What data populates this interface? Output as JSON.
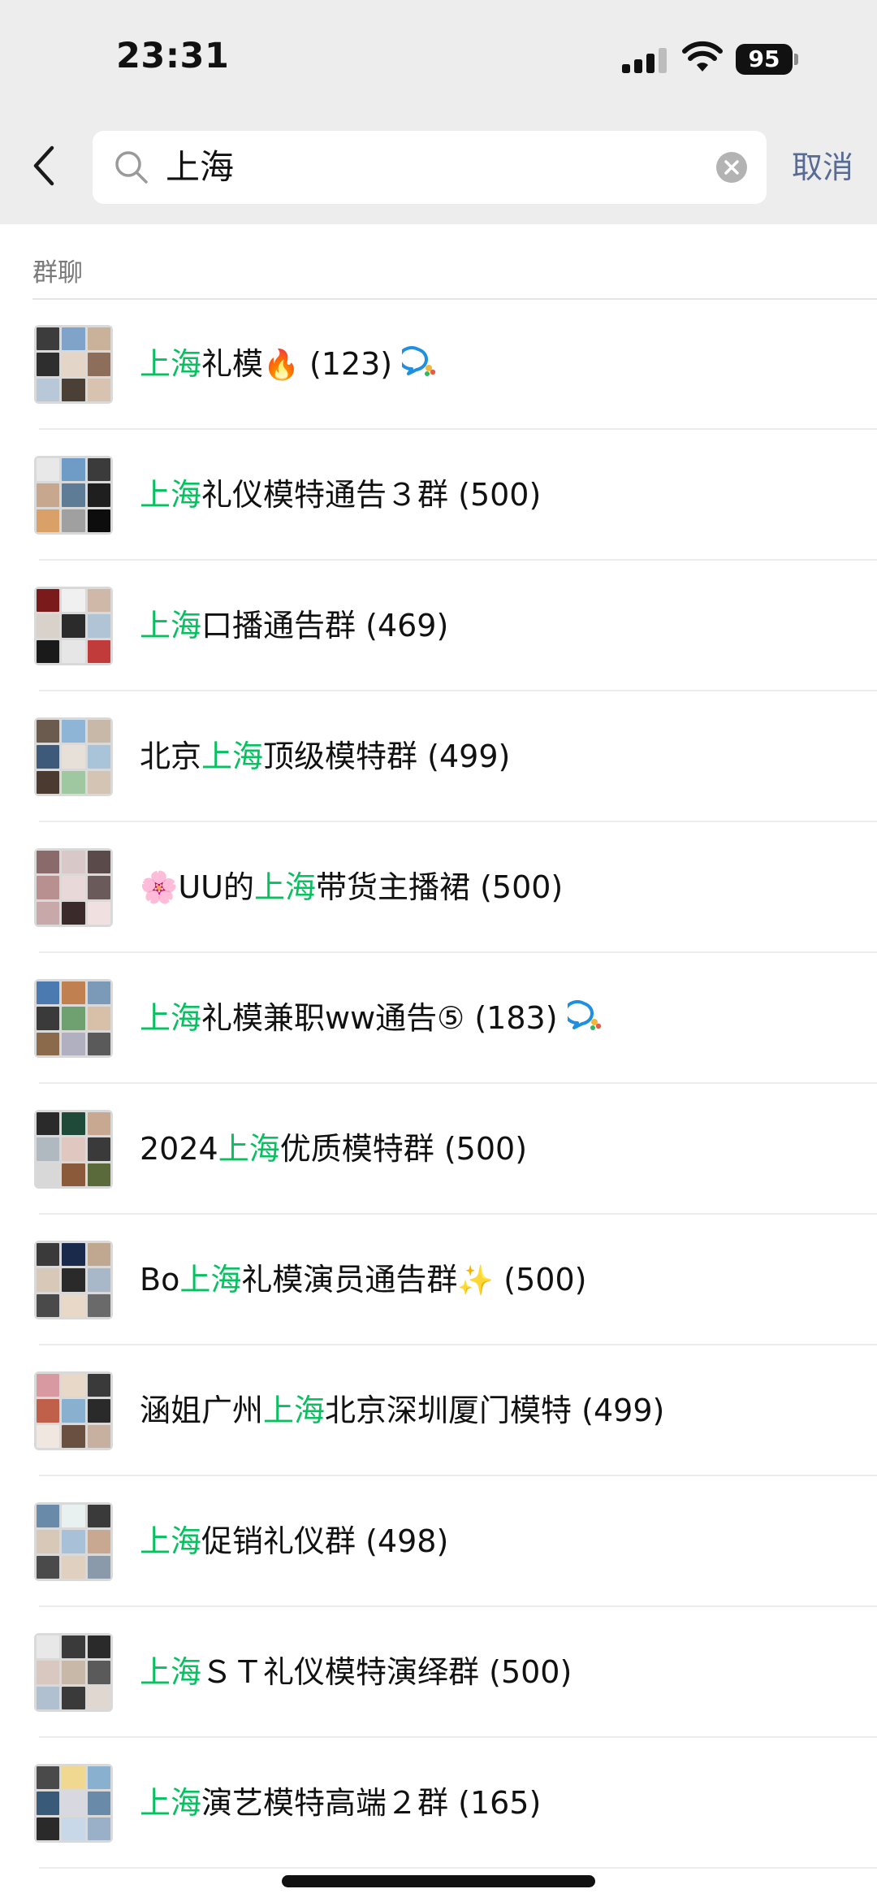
{
  "status_bar": {
    "time": "23:31",
    "battery": "95"
  },
  "search": {
    "query": "上海",
    "cancel_label": "取消"
  },
  "section": {
    "title": "群聊"
  },
  "groups": [
    {
      "pre": "",
      "hl": "上海",
      "post": "礼模",
      "emoji": "🔥",
      "count": "(123)",
      "badge": true
    },
    {
      "pre": "",
      "hl": "上海",
      "post": "礼仪模特通告３群",
      "emoji": "",
      "count": "(500)",
      "badge": false
    },
    {
      "pre": "",
      "hl": "上海",
      "post": "口播通告群",
      "emoji": "",
      "count": "(469)",
      "badge": false
    },
    {
      "pre": "北京",
      "hl": "上海",
      "post": "顶级模特群",
      "emoji": "",
      "count": "(499)",
      "badge": false
    },
    {
      "pre": "🌸UU的",
      "hl": "上海",
      "post": "带货主播裙",
      "emoji": "",
      "count": "(500)",
      "badge": false
    },
    {
      "pre": "",
      "hl": "上海",
      "post": "礼模兼职ww通告⑤",
      "emoji": "",
      "count": "(183)",
      "badge": true
    },
    {
      "pre": "2024",
      "hl": "上海",
      "post": "优质模特群",
      "emoji": "",
      "count": "(500)",
      "badge": false
    },
    {
      "pre": "Bo",
      "hl": "上海",
      "post": "礼模演员通告群",
      "emoji": "✨",
      "count": "(500)",
      "badge": false
    },
    {
      "pre": "涵姐广州",
      "hl": "上海",
      "post": "北京深圳厦门模特",
      "emoji": "",
      "count": "(499)",
      "badge": false
    },
    {
      "pre": "",
      "hl": "上海",
      "post": "促销礼仪群",
      "emoji": "",
      "count": "(498)",
      "badge": false
    },
    {
      "pre": "",
      "hl": "上海",
      "post": "ＳＴ礼仪模特演绎群",
      "emoji": "",
      "count": "(500)",
      "badge": false
    },
    {
      "pre": "",
      "hl": "上海",
      "post": "演艺模特高端２群",
      "emoji": "",
      "count": "(165)",
      "badge": false
    }
  ],
  "colors": {
    "highlight": "#07c160",
    "cancel": "#576b95",
    "header_bg": "#ededed"
  }
}
